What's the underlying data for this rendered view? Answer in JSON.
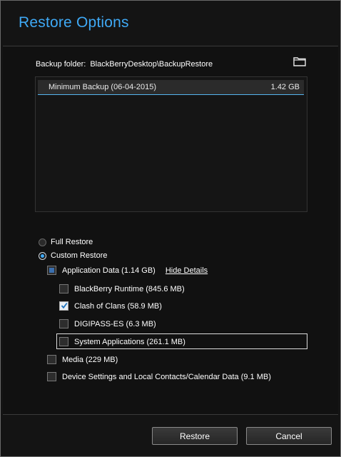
{
  "dialog": {
    "title": "Restore Options"
  },
  "backup": {
    "folder_label": "Backup folder:",
    "folder_path": "BlackBerryDesktop\\BackupRestore",
    "folder_icon": "folder-icon"
  },
  "backups_list": [
    {
      "name": "Minimum Backup (06-04-2015)",
      "size": "1.42 GB",
      "selected": true
    }
  ],
  "restore_options": {
    "full": {
      "label": "Full Restore",
      "selected": false
    },
    "custom": {
      "label": "Custom Restore",
      "selected": true
    }
  },
  "app_data": {
    "label": "Application Data (1.14 GB)",
    "hide_details": "Hide Details",
    "state": "partial",
    "items": [
      {
        "label": "BlackBerry Runtime (845.6 MB)",
        "checked": false
      },
      {
        "label": "Clash of Clans (58.9 MB)",
        "checked": true
      },
      {
        "label": "DIGIPASS-ES (6.3 MB)",
        "checked": false
      },
      {
        "label": "System Applications (261.1 MB)",
        "checked": false,
        "focused": true
      }
    ]
  },
  "media": {
    "label": "Media (229 MB)",
    "checked": false
  },
  "device_settings": {
    "label": "Device Settings and Local Contacts/Calendar Data (9.1 MB)",
    "checked": false
  },
  "buttons": {
    "restore": "Restore",
    "cancel": "Cancel"
  },
  "colors": {
    "accent": "#3fa9f5",
    "background": "#141414"
  }
}
